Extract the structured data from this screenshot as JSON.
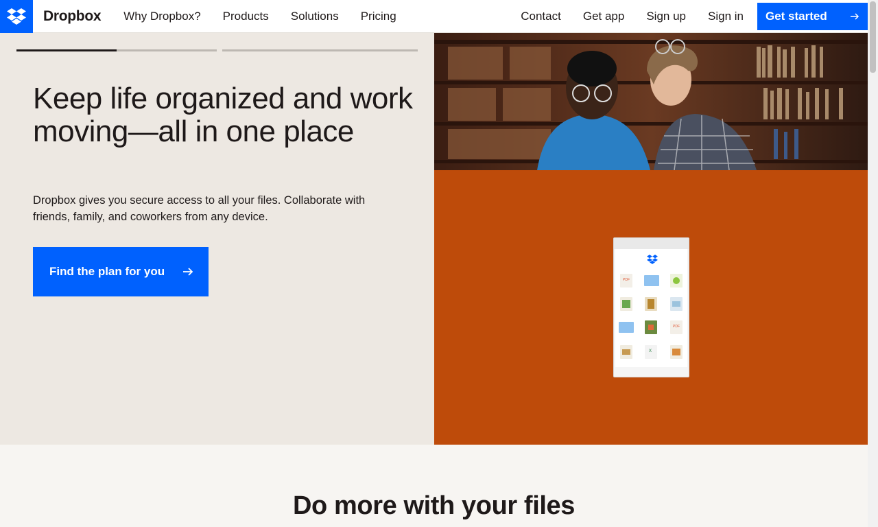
{
  "header": {
    "brand": "Dropbox",
    "nav_left": [
      "Why Dropbox?",
      "Products",
      "Solutions",
      "Pricing"
    ],
    "nav_right": [
      "Contact",
      "Get app",
      "Sign up",
      "Sign in"
    ],
    "get_started": "Get started"
  },
  "hero": {
    "carousel_progress": [
      0.5,
      0,
      0
    ],
    "title": "Keep life organized and work moving—all in one place",
    "subtitle": "Dropbox gives you secure access to all your files. Collaborate with friends, family, and coworkers from any device.",
    "cta": "Find the plan for you"
  },
  "device_preview": {
    "file_labels": [
      "PDF",
      "PDF",
      "X"
    ]
  },
  "section2": {
    "title": "Do more with your files"
  },
  "colors": {
    "brand_blue": "#0061fe",
    "hero_bg": "#ede8e2",
    "accent_orange": "#be4b0a"
  }
}
